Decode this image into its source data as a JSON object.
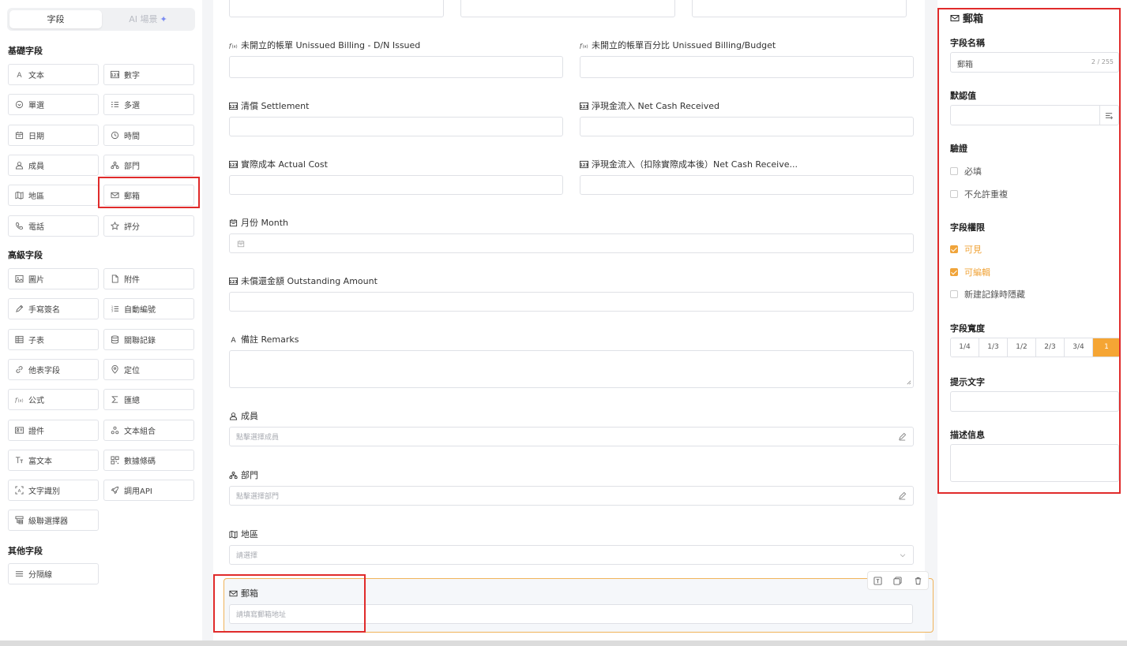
{
  "left_panel": {
    "tabs": {
      "fields": "字段",
      "ai": "AI 場景"
    },
    "basic_title": "基礎字段",
    "basic": [
      {
        "label": "文本",
        "icon": "text-icon"
      },
      {
        "label": "數字",
        "icon": "number-icon"
      },
      {
        "label": "單選",
        "icon": "single-select-icon"
      },
      {
        "label": "多選",
        "icon": "multi-select-icon"
      },
      {
        "label": "日期",
        "icon": "calendar-icon"
      },
      {
        "label": "時間",
        "icon": "clock-icon"
      },
      {
        "label": "成員",
        "icon": "user-icon"
      },
      {
        "label": "部門",
        "icon": "org-icon"
      },
      {
        "label": "地區",
        "icon": "map-icon"
      },
      {
        "label": "郵箱",
        "icon": "mail-icon"
      },
      {
        "label": "電話",
        "icon": "phone-icon"
      },
      {
        "label": "評分",
        "icon": "star-icon"
      }
    ],
    "advanced_title": "高級字段",
    "advanced": [
      {
        "label": "圖片",
        "icon": "image-icon"
      },
      {
        "label": "附件",
        "icon": "file-icon"
      },
      {
        "label": "手寫簽名",
        "icon": "pen-icon"
      },
      {
        "label": "自動編號",
        "icon": "numbered-list-icon"
      },
      {
        "label": "子表",
        "icon": "table-icon"
      },
      {
        "label": "關聯記錄",
        "icon": "database-icon"
      },
      {
        "label": "他表字段",
        "icon": "link-icon"
      },
      {
        "label": "定位",
        "icon": "location-icon"
      },
      {
        "label": "公式",
        "icon": "formula-icon"
      },
      {
        "label": "匯總",
        "icon": "sigma-icon"
      },
      {
        "label": "證件",
        "icon": "id-card-icon"
      },
      {
        "label": "文本組合",
        "icon": "combine-icon"
      },
      {
        "label": "富文本",
        "icon": "rich-text-icon"
      },
      {
        "label": "數據條碼",
        "icon": "qrcode-icon"
      },
      {
        "label": "文字識別",
        "icon": "ocr-icon"
      },
      {
        "label": "調用API",
        "icon": "rocket-icon"
      },
      {
        "label": "級聯選擇器",
        "icon": "cascade-icon"
      }
    ],
    "other_title": "其他字段",
    "other": [
      {
        "label": "分隔線",
        "icon": "divider-icon"
      }
    ]
  },
  "form": {
    "fields": [
      {
        "label": "未開立的帳單 Unissued Billing - D/N Issued",
        "icon": "formula-icon"
      },
      {
        "label": "未開立的帳單百分比 Unissued Billing/Budget",
        "icon": "formula-icon"
      },
      {
        "label": "清償 Settlement",
        "icon": "number-icon"
      },
      {
        "label": "淨現金流入 Net Cash Received",
        "icon": "number-icon"
      },
      {
        "label": "實際成本 Actual Cost",
        "icon": "number-icon"
      },
      {
        "label": "淨現金流入（扣除實際成本後）Net Cash Receive...",
        "icon": "number-icon"
      },
      {
        "label": "月份 Month",
        "icon": "calendar-icon"
      },
      {
        "label": "未償還金額 Outstanding Amount",
        "icon": "number-icon"
      },
      {
        "label": "備註 Remarks",
        "icon": "text-icon"
      },
      {
        "label": "成員",
        "icon": "user-icon",
        "placeholder": "點擊選擇成員"
      },
      {
        "label": "部門",
        "icon": "org-icon",
        "placeholder": "點擊選擇部門"
      },
      {
        "label": "地區",
        "icon": "map-icon",
        "placeholder": "請選擇"
      },
      {
        "label": "郵箱",
        "icon": "mail-icon",
        "placeholder": "請填寫郵箱地址"
      }
    ]
  },
  "props": {
    "title": "郵箱",
    "name_label": "字段名稱",
    "name_value": "郵箱",
    "name_count": "2 / 255",
    "default_label": "默認值",
    "validation_label": "驗證",
    "required": "必填",
    "no_duplicate": "不允許重複",
    "permission_label": "字段權限",
    "visible": "可見",
    "editable": "可編輯",
    "hide_on_new": "新建記錄時隱藏",
    "width_label": "字段寬度",
    "widths": [
      "1/4",
      "1/3",
      "1/2",
      "2/3",
      "3/4",
      "1"
    ],
    "width_selected": "1",
    "hint_label": "提示文字",
    "desc_label": "描述信息",
    "accent": "#f5a534",
    "highlight": "#e02b2b"
  }
}
